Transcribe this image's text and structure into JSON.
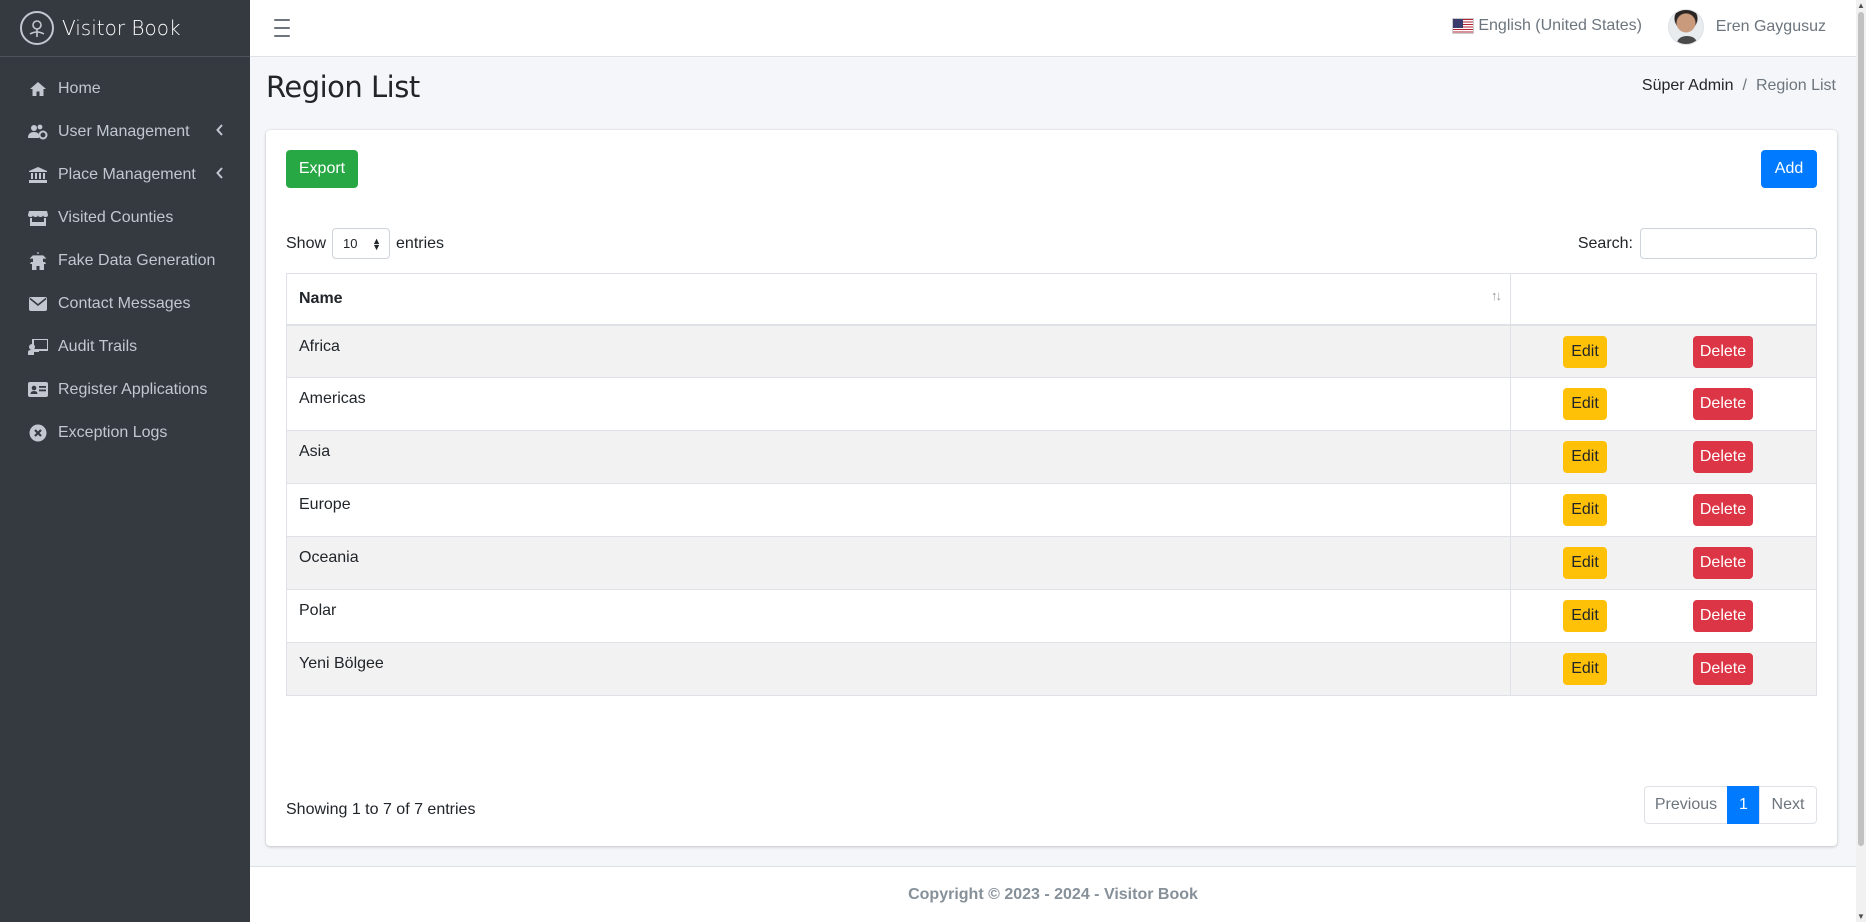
{
  "app": {
    "brand": "Visitor Book"
  },
  "sidebar": {
    "items": [
      {
        "label": "Home",
        "icon": "home-icon"
      },
      {
        "label": "User Management",
        "icon": "users-cog-icon",
        "has_submenu": true
      },
      {
        "label": "Place Management",
        "icon": "landmark-icon",
        "has_submenu": true
      },
      {
        "label": "Visited Counties",
        "icon": "store-icon"
      },
      {
        "label": "Fake Data Generation",
        "icon": "vihara-icon"
      },
      {
        "label": "Contact Messages",
        "icon": "envelope-icon"
      },
      {
        "label": "Audit Trails",
        "icon": "chalkboard-teacher-icon"
      },
      {
        "label": "Register Applications",
        "icon": "id-card-icon"
      },
      {
        "label": "Exception Logs",
        "icon": "times-circle-icon"
      }
    ]
  },
  "topbar": {
    "language": "English (United States)",
    "user_name": "Eren Gaygusuz"
  },
  "page": {
    "title": "Region List",
    "breadcrumb": {
      "parent": "Süper Admin",
      "separator": "/",
      "current": "Region List"
    }
  },
  "toolbar": {
    "export_label": "Export",
    "add_label": "Add"
  },
  "datatable": {
    "show_label": "Show",
    "page_length": "10",
    "entries_label": "entries",
    "search_label": "Search:",
    "search_value": "",
    "columns": [
      "Name",
      ""
    ],
    "rows": [
      {
        "name": "Africa"
      },
      {
        "name": "Americas"
      },
      {
        "name": "Asia"
      },
      {
        "name": "Europe"
      },
      {
        "name": "Oceania"
      },
      {
        "name": "Polar"
      },
      {
        "name": "Yeni Bölgee"
      }
    ],
    "edit_label": "Edit",
    "delete_label": "Delete",
    "info": "Showing 1 to 7 of 7 entries",
    "pagination": {
      "previous": "Previous",
      "current": "1",
      "next": "Next"
    }
  },
  "footer": {
    "text": "Copyright © 2023 - 2024 - Visitor Book"
  },
  "colors": {
    "sidebar_bg": "#343a40",
    "primary": "#007bff",
    "success": "#28a745",
    "warning": "#ffc107",
    "danger": "#dc3545"
  }
}
